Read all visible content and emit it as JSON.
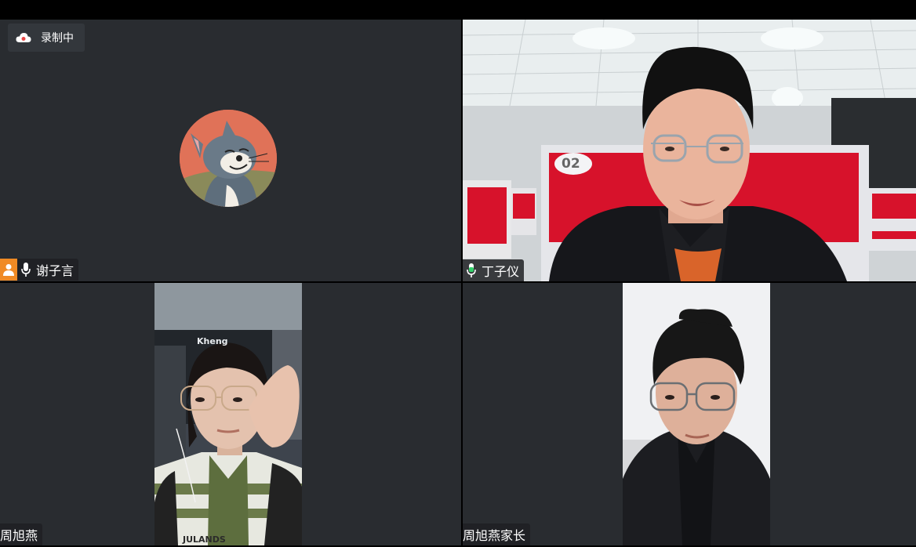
{
  "meeting": {
    "recording_label": "录制中",
    "participants": [
      {
        "name": "谢子言",
        "is_host": true,
        "mic": "on"
      },
      {
        "name": "丁子仪",
        "is_host": false,
        "mic": "active"
      },
      {
        "name": "周旭燕",
        "is_host": false,
        "mic": "none"
      },
      {
        "name": "周旭燕家长",
        "is_host": false,
        "mic": "none"
      }
    ],
    "video_text": {
      "room_number": "02",
      "sign": "Kheng",
      "shirt": "JULANDS"
    }
  },
  "colors": {
    "tile_bg": "#292c30",
    "active_speaker_border": "#33d06a",
    "host_badge": "#f08a24",
    "mic_active": "#33d06a"
  }
}
